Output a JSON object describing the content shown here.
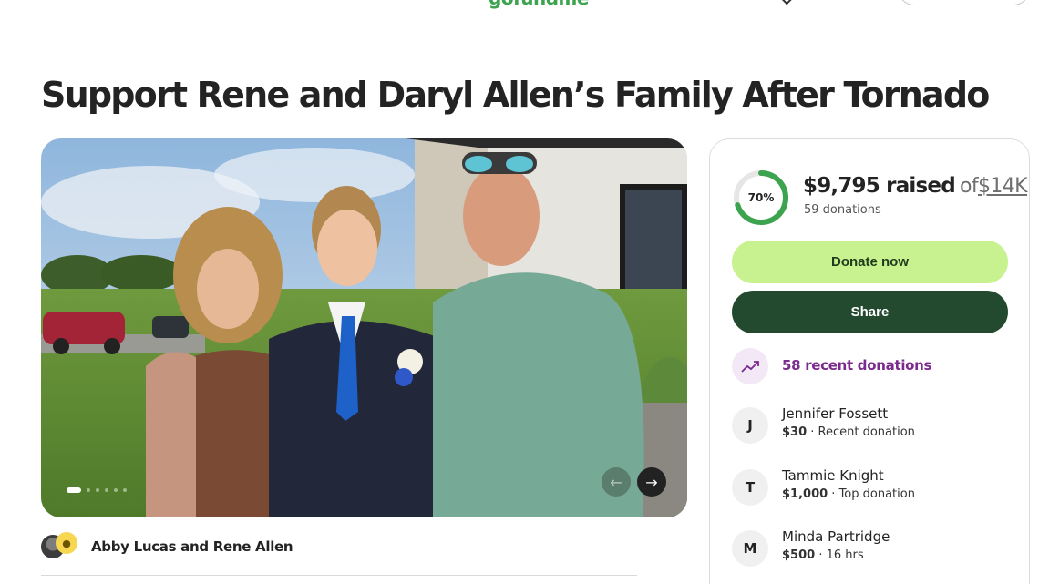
{
  "header": {
    "logo_text": "gofundme"
  },
  "campaign": {
    "title": "Support Rene and Daryl Allen’s Family After Tornado"
  },
  "gallery": {
    "slide_count": 6,
    "active_slide": 1
  },
  "organizer": {
    "name": "Abby Lucas and Rene Allen"
  },
  "progress": {
    "percent_label": "70%",
    "percent_value": 0.7,
    "raised": "$9,795 raised",
    "of_text": "of",
    "goal": "$14K",
    "donations": "59 donations"
  },
  "actions": {
    "donate_label": "Donate now",
    "share_label": "Share"
  },
  "recent": {
    "label": "58 recent donations"
  },
  "donors": [
    {
      "initial": "J",
      "name": "Jennifer Fossett",
      "amount": "$30",
      "note": " · Recent donation"
    },
    {
      "initial": "T",
      "name": "Tammie Knight",
      "amount": "$1,000",
      "note": " · Top donation"
    },
    {
      "initial": "M",
      "name": "Minda Partridge",
      "amount": "$500",
      "note": " · 16 hrs"
    }
  ],
  "colors": {
    "brand_green": "#3ca34f",
    "donate_bg": "#c8f28f",
    "share_bg": "#234a2f",
    "recent_purple": "#7b2a8d"
  }
}
